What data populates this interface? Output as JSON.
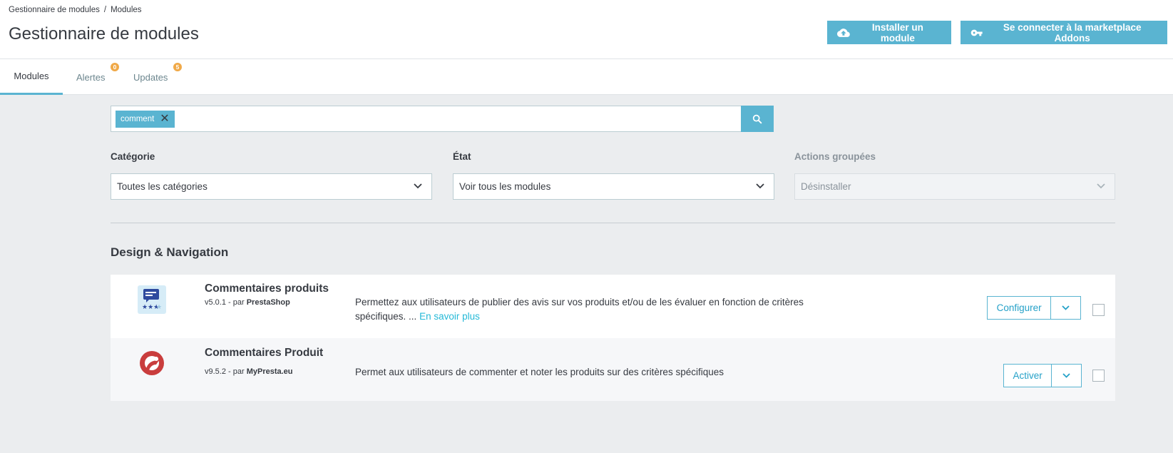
{
  "breadcrumb": {
    "parent": "Gestionnaire de modules",
    "separator": "/",
    "current": "Modules"
  },
  "header": {
    "title": "Gestionnaire de modules",
    "install_button": "Installer un module",
    "connect_button": "Se connecter à la marketplace Addons"
  },
  "tabs": [
    {
      "label": "Modules",
      "active": true
    },
    {
      "label": "Alertes",
      "badge": "0"
    },
    {
      "label": "Updates",
      "badge": "5"
    }
  ],
  "search": {
    "tag": "comment"
  },
  "filters": {
    "category": {
      "label": "Catégorie",
      "value": "Toutes les catégories"
    },
    "state": {
      "label": "État",
      "value": "Voir tous les modules"
    },
    "bulk": {
      "label": "Actions groupées",
      "value": "Désinstaller"
    }
  },
  "section": {
    "title": "Design & Navigation"
  },
  "modules": [
    {
      "name": "Commentaires produits",
      "version": "v5.0.1 - par",
      "author": "PrestaShop",
      "description": "Permettez aux utilisateurs de publier des avis sur vos produits et/ou de les évaluer en fonction de critères spécifiques. ...",
      "read_more": "En savoir plus",
      "action": "Configurer",
      "logo_icon": "chat-stars-icon"
    },
    {
      "name": "Commentaires Produit",
      "version": "v9.5.2 - par",
      "author": "MyPresta.eu",
      "description": "Permet aux utilisateurs de commenter et noter les produits sur des critères spécifiques",
      "action": "Activer",
      "logo_icon": "mypresta-logo-icon"
    }
  ],
  "colors": {
    "primary": "#5ab4d1",
    "badge": "#f0a948",
    "link": "#25b9d7"
  }
}
